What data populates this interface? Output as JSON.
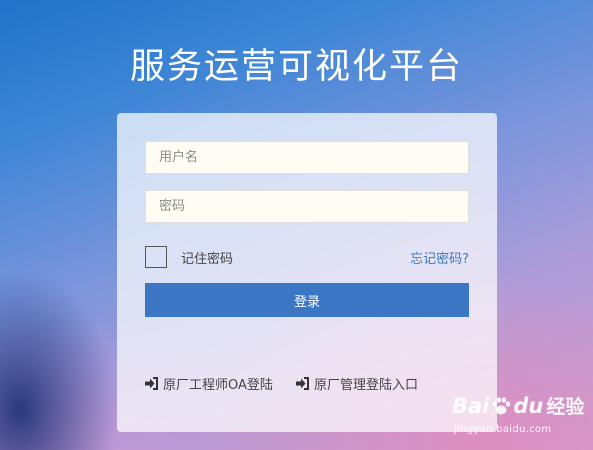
{
  "page": {
    "title": "服务运营可视化平台"
  },
  "login": {
    "username_placeholder": "用户名",
    "password_placeholder": "密码",
    "remember_label": "记住密码",
    "forgot_label": "忘记密码?",
    "submit_label": "登录"
  },
  "links": [
    {
      "label": "原厂工程师OA登陆",
      "icon": "sign-in-icon"
    },
    {
      "label": "原厂管理登陆入口",
      "icon": "sign-in-icon"
    }
  ],
  "watermark": {
    "brand_bai": "Bai",
    "brand_du": "du",
    "brand_suffix": "经验",
    "url": "jingyan.baidu.com"
  },
  "colors": {
    "primary_button": "#3c77c6",
    "link": "#3d78b8",
    "input_background": "#fffdf3"
  }
}
